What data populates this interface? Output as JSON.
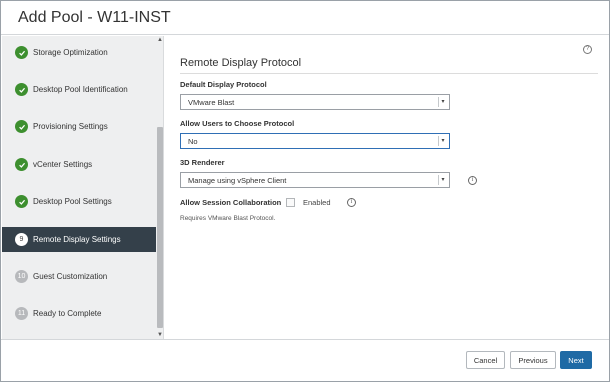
{
  "dialog": {
    "title": "Add Pool - W11-INST"
  },
  "sidebar": {
    "steps": [
      {
        "number": "",
        "label": "Storage Optimization",
        "state": "done"
      },
      {
        "number": "",
        "label": "Desktop Pool Identification",
        "state": "done"
      },
      {
        "number": "",
        "label": "Provisioning Settings",
        "state": "done"
      },
      {
        "number": "",
        "label": "vCenter Settings",
        "state": "done"
      },
      {
        "number": "",
        "label": "Desktop Pool Settings",
        "state": "done"
      },
      {
        "number": "9",
        "label": "Remote Display Settings",
        "state": "active"
      },
      {
        "number": "10",
        "label": "Guest Customization",
        "state": "pending"
      },
      {
        "number": "11",
        "label": "Ready to Complete",
        "state": "pending"
      }
    ]
  },
  "main": {
    "section_title": "Remote Display Protocol",
    "help": "?",
    "info": "i",
    "default_protocol": {
      "label": "Default Display Protocol",
      "value": "VMware Blast"
    },
    "allow_choose": {
      "label": "Allow Users to Choose Protocol",
      "value": "No"
    },
    "renderer": {
      "label": "3D Renderer",
      "value": "Manage using vSphere Client"
    },
    "session_collab": {
      "label": "Allow Session Collaboration",
      "checkbox_label": "Enabled",
      "checked": false
    },
    "note": "Requires VMware Blast Protocol."
  },
  "footer": {
    "cancel": "Cancel",
    "previous": "Previous",
    "next": "Next"
  },
  "colors": {
    "accent": "#1f6aa5",
    "done": "#3d8f2f",
    "active_row": "#34404a"
  }
}
